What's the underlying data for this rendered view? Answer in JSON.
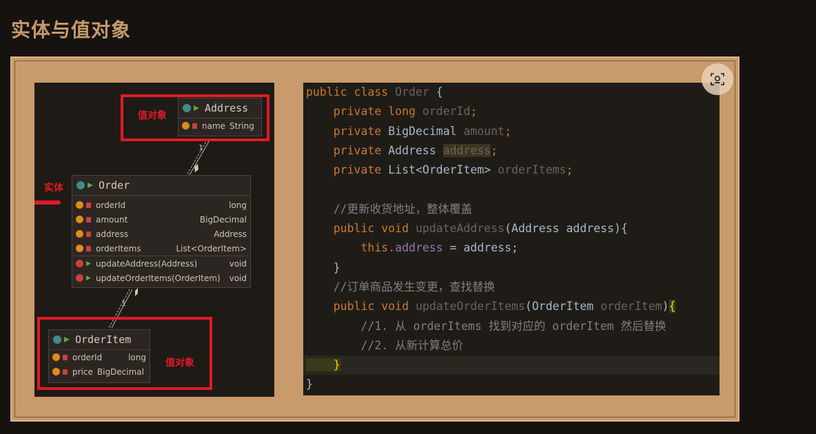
{
  "page_title": "实体与值对象",
  "uml": {
    "address_box": {
      "name": "Address",
      "fields": [
        {
          "name": "name",
          "type": "String"
        }
      ]
    },
    "order_box": {
      "name": "Order",
      "fields": [
        {
          "name": "orderId",
          "type": "long"
        },
        {
          "name": "amount",
          "type": "BigDecimal"
        },
        {
          "name": "address",
          "type": "Address"
        },
        {
          "name": "orderItems",
          "type": "List<OrderItem>"
        }
      ],
      "methods": [
        {
          "name": "updateAddress(Address)",
          "type": "void"
        },
        {
          "name": "updateOrderItems(OrderItem)",
          "type": "void"
        }
      ]
    },
    "orderitem_box": {
      "name": "OrderItem",
      "fields": [
        {
          "name": "orderId",
          "type": "long"
        },
        {
          "name": "price",
          "type": "BigDecimal"
        }
      ]
    },
    "label_value_object_top": "值对象",
    "label_entity": "实体",
    "label_value_object_bottom": "值对象",
    "assoc_label_1": "1",
    "assoc_label_n": "*"
  },
  "code": {
    "l1_kw": "public class ",
    "l1_name": "Order",
    "l1_end": " {",
    "l2_kw": "    private long ",
    "l2_f": "orderId",
    "l3_kw": "    private ",
    "l3_t": "BigDecimal ",
    "l3_f": "amount",
    "l4_kw": "    private ",
    "l4_t": "Address ",
    "l4_f": "address",
    "l5_kw": "    private ",
    "l5_t": "List<OrderItem> ",
    "l5_f": "orderItems",
    "l7": "    //更新收货地址，整体覆盖",
    "l8_kw": "    public void ",
    "l8_m": "updateAddress",
    "l8_rest": "(Address address){",
    "l9_kw": "        this.",
    "l9_f": "address",
    "l9_rest": " = address;",
    "l10": "    }",
    "l11": "    //订单商品发生变更，查找替换",
    "l12_kw": "    public void ",
    "l12_m": "updateOrderItems",
    "l12_rest": "(OrderItem ",
    "l12_p": "orderItem",
    "l12_end": ")",
    "l12_brace": "{",
    "l13": "        //1. 从 orderItems 找到对应的 orderItem 然后替换",
    "l14": "        //2. 从新计算总价",
    "l15": "    }",
    "l16": "}",
    "semicolon": ";"
  },
  "icons": {
    "zoom_button": "scan-icon"
  }
}
